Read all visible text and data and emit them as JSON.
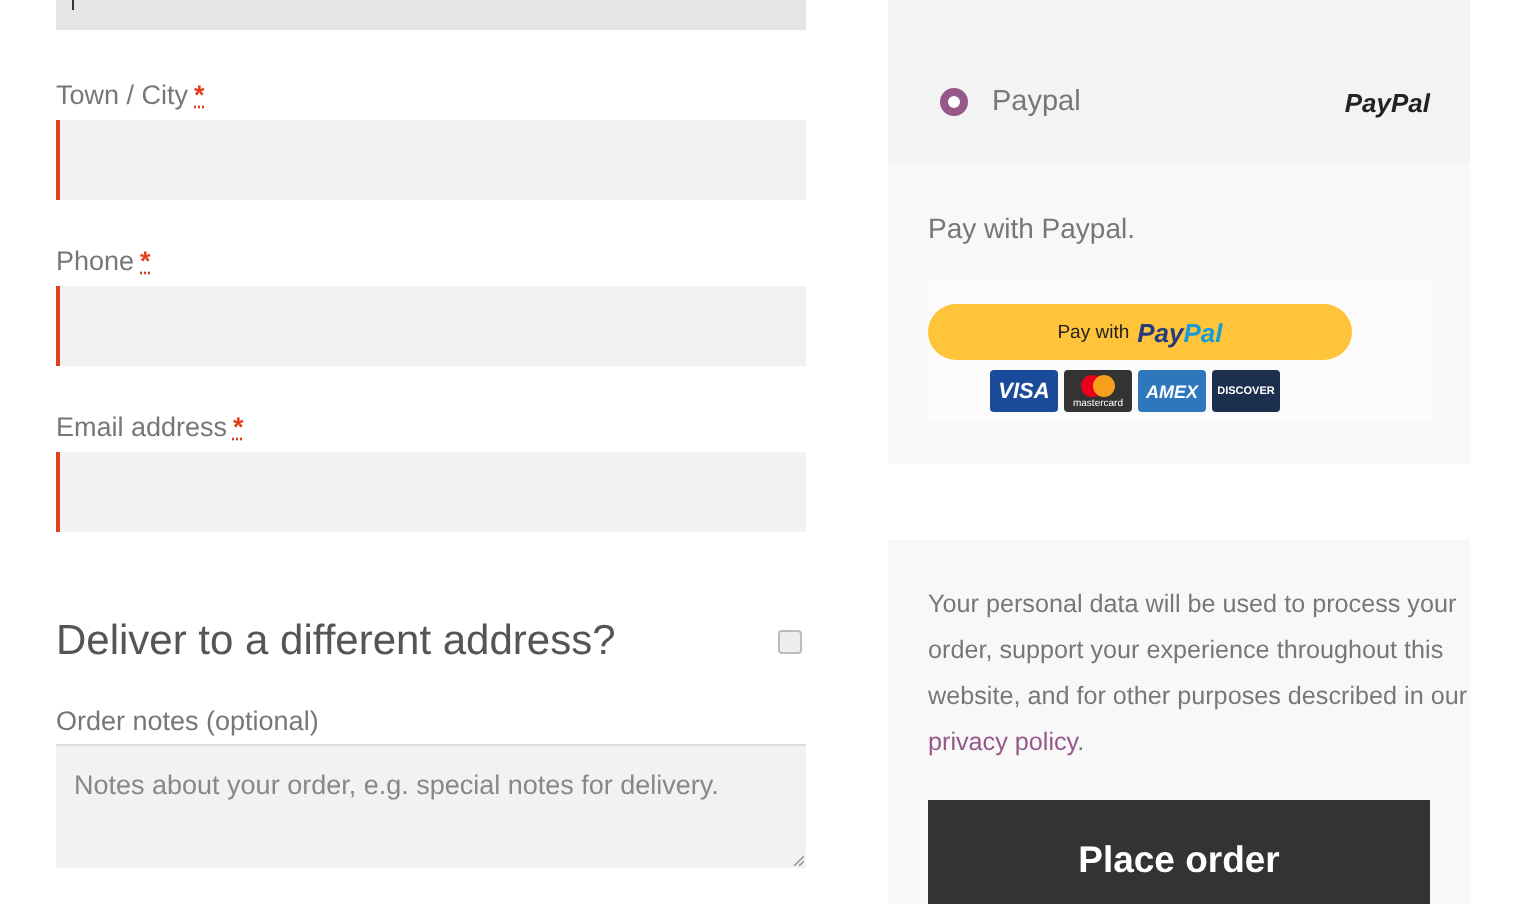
{
  "partial_field": {
    "focused": true
  },
  "fields": [
    {
      "label": "Town / City",
      "required_mark": "*",
      "invalid": true
    },
    {
      "label": "Phone",
      "required_mark": "*",
      "invalid": true
    },
    {
      "label": "Email address",
      "required_mark": "*",
      "invalid": true
    }
  ],
  "shipping": {
    "heading": "Deliver to a different address?",
    "checked": false
  },
  "order_notes": {
    "label": "Order notes (optional)",
    "placeholder": "Notes about your order, e.g. special notes for delivery."
  },
  "payment": {
    "method": {
      "label": "Paypal",
      "selected": true,
      "logo": "PayPal"
    },
    "description": "Pay with Paypal.",
    "button": {
      "prefix": "Pay with",
      "brand_left": "Pay",
      "brand_right": "Pal"
    },
    "cards": [
      {
        "label": "VISA",
        "kind": "visa"
      },
      {
        "label": "mastercard",
        "kind": "mastercard"
      },
      {
        "label": "AMEX",
        "kind": "amex"
      },
      {
        "label": "DISCOVER",
        "kind": "discover"
      }
    ]
  },
  "privacy": {
    "text": "Your personal data will be used to process your order, support your experience throughout this website, and for other purposes described in our",
    "link": "privacy policy",
    "end": "."
  },
  "place_order": "Place order"
}
